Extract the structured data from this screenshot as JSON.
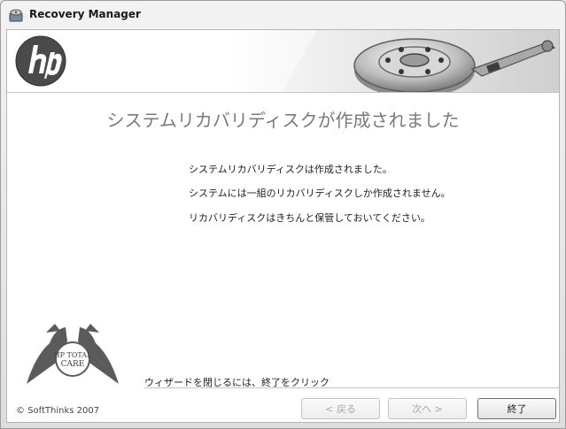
{
  "window": {
    "title": "Recovery Manager",
    "icon": "recovery-manager-icon"
  },
  "banner": {
    "logo": "hp-logo",
    "art": "hard-disk-drive-illustration"
  },
  "content": {
    "heading": "システムリカバリディスクが作成されました",
    "messages": [
      "システムリカバリディスクは作成されました。",
      "システムには一組のリカバリディスクしか作成されません。",
      "リカバリディスクはきちんと保管しておいてください。"
    ]
  },
  "care_logo": {
    "line1": "HP TOTAL",
    "line2": "CARE"
  },
  "footer": {
    "hint": "ウィザードを閉じるには、終了をクリック",
    "copyright": "© SoftThinks 2007",
    "buttons": {
      "back": "< 戻る",
      "next": "次へ >",
      "finish": "終了"
    }
  },
  "colors": {
    "accent": "#5b5b5b",
    "heading_text": "#7a7a7a"
  }
}
